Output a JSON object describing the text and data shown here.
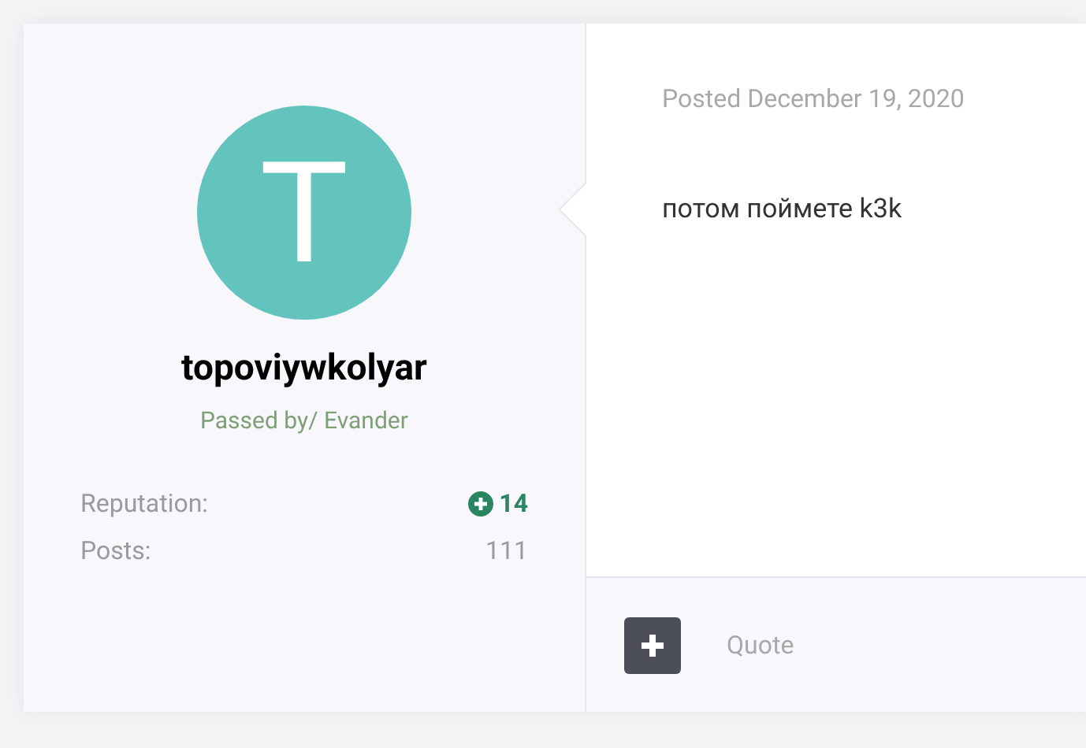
{
  "author": {
    "initial": "T",
    "name": "topoviywkolyar",
    "group": "Passed by/ Evander"
  },
  "stats": [
    {
      "kind": "reputation",
      "label": "Reputation:",
      "value": "14"
    },
    {
      "kind": "plain",
      "label": "Posts:",
      "value": "111"
    }
  ],
  "post": {
    "date": "Posted December 19, 2020",
    "content": "потом поймете k3k"
  },
  "footer": {
    "quote": "Quote"
  }
}
